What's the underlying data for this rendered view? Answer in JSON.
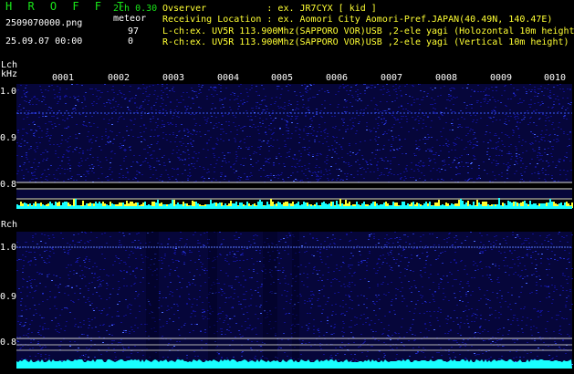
{
  "header": {
    "brand": "H R O F F T",
    "version": "2ch 0.30",
    "filename": "2509070000.png",
    "datetime": "25.09.07 00:00",
    "meteor_label": "meteor",
    "meteor_count_l": "97",
    "meteor_count_r": "0",
    "observer_line": "Ovserver           : ex. JR7CYX [ kid ]",
    "location_line": "Receiving Location : ex. Aomori City Aomori-Pref.JAPAN(40.49N, 140.47E)",
    "lch_line": "L-ch:ex. UV5R 113.900Mhz(SAPPORO VOR)USB ,2-ele yagi (Holozontal 10m height)",
    "rch_line": "R-ch:ex. UV5R 113.900Mhz(SAPPORO VOR)USB ,2-ele yagi (Vertical 10m height)"
  },
  "lch_panel": {
    "label": "Lch",
    "unit": "kHz",
    "ticks": [
      "1.0",
      "0.9",
      "0.8"
    ],
    "minutes": [
      "0001",
      "0002",
      "0003",
      "0004",
      "0005",
      "0006",
      "0007",
      "0008",
      "0009",
      "0010"
    ]
  },
  "rch_panel": {
    "label": "Rch",
    "ticks": [
      "1.0",
      "0.9",
      "0.8"
    ]
  },
  "colors": {
    "background": "#000000",
    "noise": "#0a0a7a",
    "trace": "#ffffff",
    "meteor_ping": "#ffff33",
    "baseline": "#19ffff",
    "text_green": "#19e619"
  }
}
